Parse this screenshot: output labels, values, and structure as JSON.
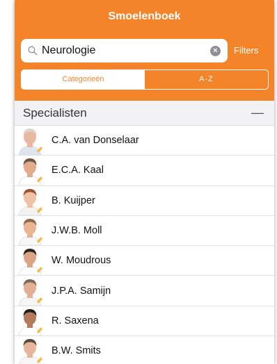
{
  "header": {
    "title": "Smoelenboek",
    "search_value": "Neurologie",
    "filters_label": "Filters",
    "tabs": [
      {
        "label": "Categorieën"
      },
      {
        "label": "A-Z"
      }
    ]
  },
  "section": {
    "title": "Specialisten",
    "collapse_symbol": "—"
  },
  "specialists": [
    {
      "name": "C.A. van Donselaar",
      "hair": "#d9d5cf",
      "skin": "#e8b9a0",
      "shirt": "#dfe6ee"
    },
    {
      "name": "E.C.A. Kaal",
      "hair": "#6b5443",
      "skin": "#e1ab8c",
      "shirt": "#ffffff"
    },
    {
      "name": "B. Kuijper",
      "hair": "#9a5530",
      "skin": "#f0c1a4",
      "shirt": "#f3f3f3"
    },
    {
      "name": "J.W.B. Moll",
      "hair": "#8a6b4e",
      "skin": "#eab494",
      "shirt": "#f7f7f7"
    },
    {
      "name": "W. Moudrous",
      "hair": "#2b2420",
      "skin": "#d9a585",
      "shirt": "#ffffff"
    },
    {
      "name": "J.P.A. Samijn",
      "hair": "#7a6a5a",
      "skin": "#e2b096",
      "shirt": "#f5f5f5"
    },
    {
      "name": "R. Saxena",
      "hair": "#231c19",
      "skin": "#b47b5b",
      "shirt": "#ffffff"
    },
    {
      "name": "B.W. Smits",
      "hair": "#5a4a3c",
      "skin": "#e8b79b",
      "shirt": "#f7f7f7"
    }
  ],
  "colors": {
    "accent": "#f4842a",
    "badge": "#f4b94a"
  }
}
